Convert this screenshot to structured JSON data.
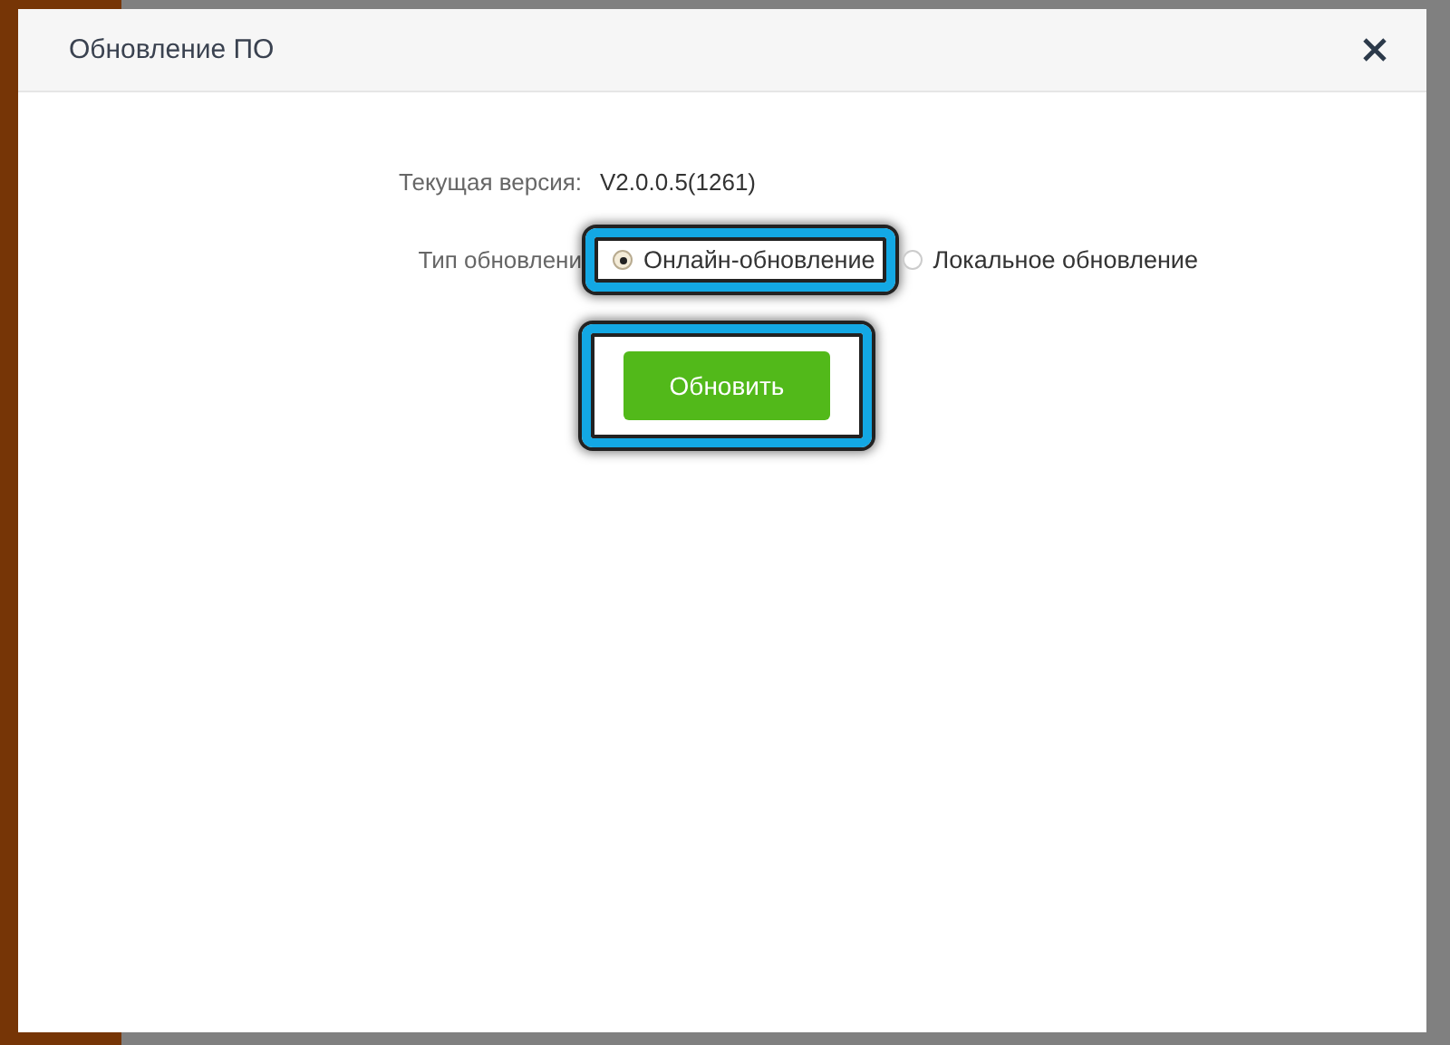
{
  "dialog": {
    "title": "Обновление ПО",
    "fields": [
      {
        "kind": "text",
        "label": "Текущая версия:",
        "value": "V2.0.0.5(1261)"
      },
      {
        "kind": "radio",
        "label": "Тип обновлени",
        "options": [
          {
            "label": "Онлайн-обновление",
            "selected": true,
            "highlighted": true
          },
          {
            "label": "Локальное обновление",
            "selected": false,
            "highlighted": false
          }
        ]
      }
    ],
    "button": {
      "label": "Обновить",
      "highlighted": true
    }
  }
}
